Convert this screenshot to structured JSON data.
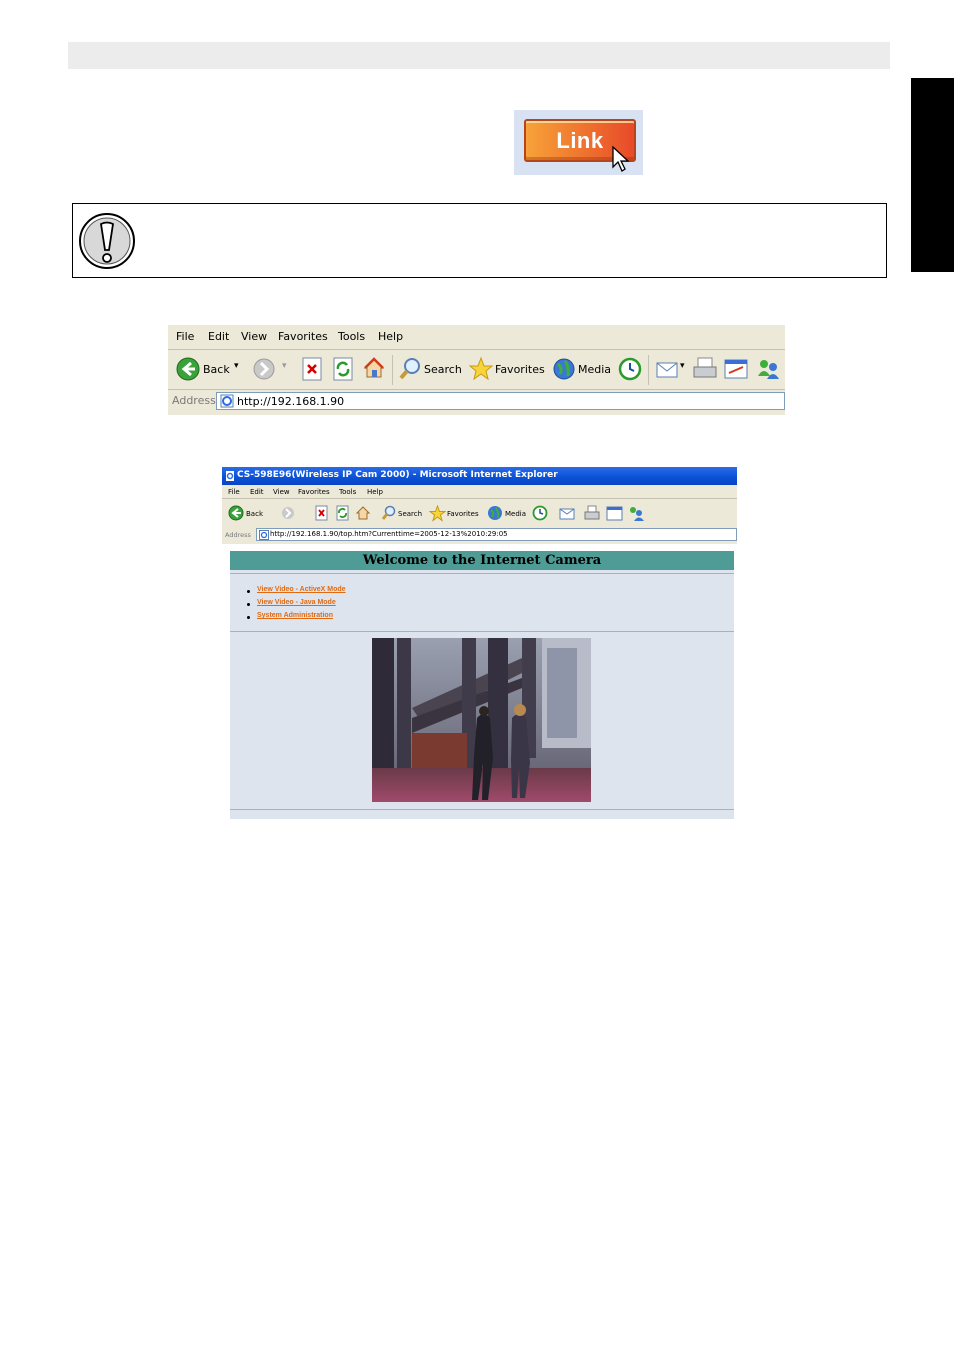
{
  "link_button": {
    "label": "Link"
  },
  "toolbar_closeup": {
    "menu": [
      "File",
      "Edit",
      "View",
      "Favorites",
      "Tools",
      "Help"
    ],
    "buttons": {
      "back": "Back",
      "search": "Search",
      "favorites": "Favorites",
      "media": "Media"
    },
    "address_label": "Address",
    "address_value": "http://192.168.1.90"
  },
  "browser_window": {
    "title": "CS-598E96(Wireless IP Cam 2000) - Microsoft Internet Explorer",
    "menu": [
      "File",
      "Edit",
      "View",
      "Favorites",
      "Tools",
      "Help"
    ],
    "buttons": {
      "back": "Back",
      "search": "Search",
      "favorites": "Favorites",
      "media": "Media"
    },
    "address_label": "Address",
    "address_value": "http://192.168.1.90/top.htm?Currenttime=2005-12-13%2010:29:05",
    "page_heading": "Welcome to the Internet Camera",
    "links": [
      "View Video - ActiveX Mode",
      "View Video - Java Mode",
      "System Administration"
    ]
  },
  "colors": {
    "link_button": "#f07b30",
    "heading_bar": "#4f9c96",
    "xp_title": "#0a4fd6",
    "camera_link": "#e06a12"
  }
}
